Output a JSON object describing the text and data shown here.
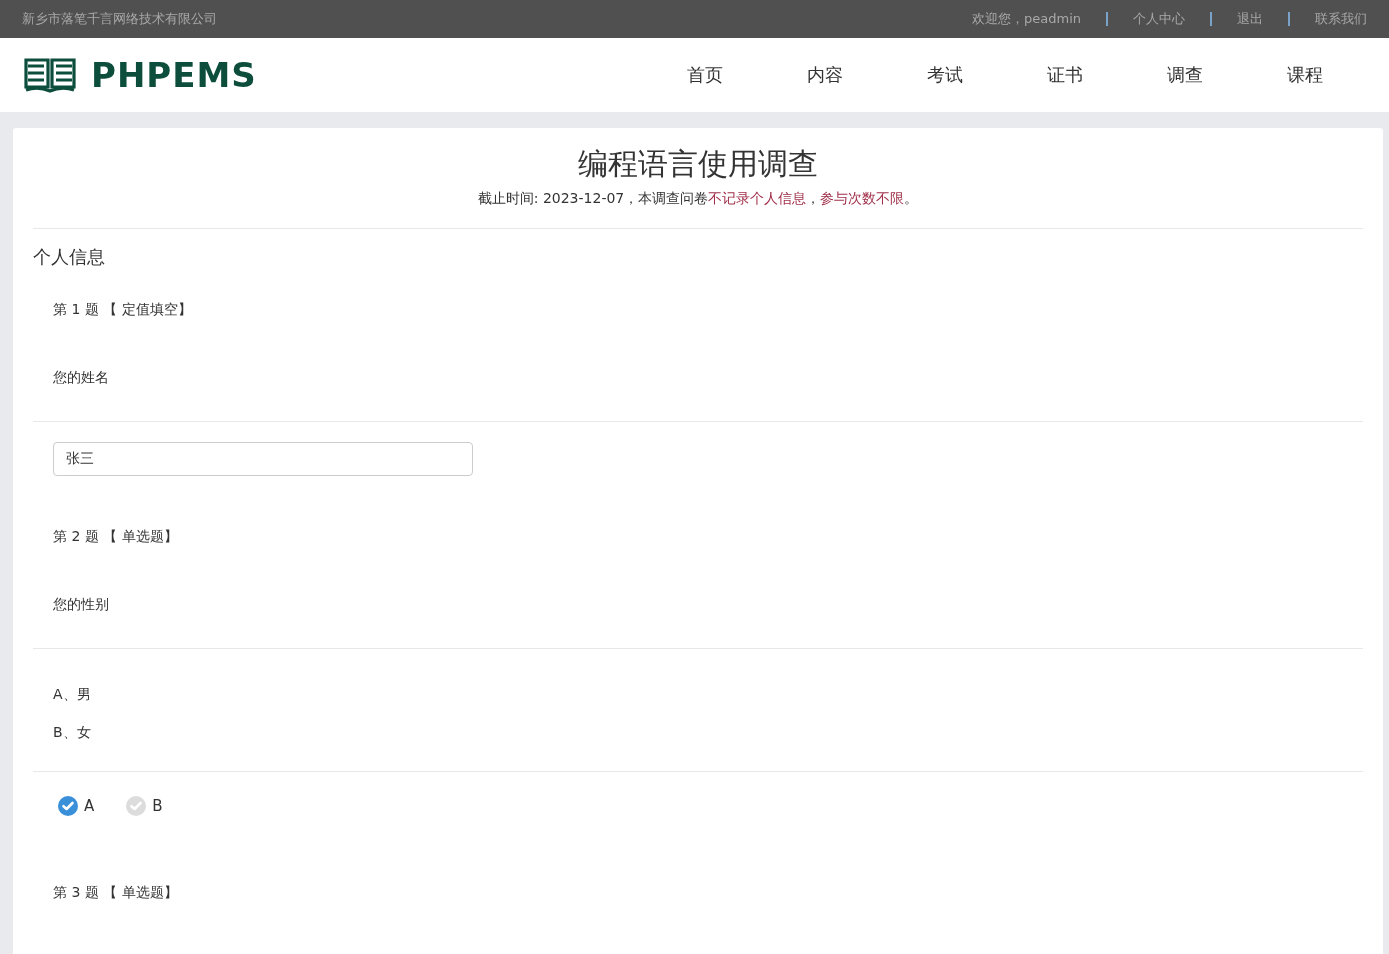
{
  "top_bar": {
    "company": "新乡市落笔千言网络技术有限公司",
    "links": [
      {
        "label": "欢迎您，peadmin"
      },
      {
        "label": "个人中心"
      },
      {
        "label": "退出"
      },
      {
        "label": "联系我们"
      }
    ]
  },
  "header": {
    "logo_text": "PHPEMS",
    "nav": [
      {
        "label": "首页"
      },
      {
        "label": "内容"
      },
      {
        "label": "考试"
      },
      {
        "label": "证书"
      },
      {
        "label": "调查"
      },
      {
        "label": "课程"
      }
    ]
  },
  "survey": {
    "title": "编程语言使用调查",
    "notice": [
      {
        "kind": "plain",
        "text": "截止时间: 2023-12-07，本调查问卷"
      },
      {
        "kind": "notice",
        "text": "不记录个人信息"
      },
      {
        "kind": "plain",
        "text": "，"
      },
      {
        "kind": "notice",
        "text": "参与次数不限"
      },
      {
        "kind": "plain",
        "text": "。"
      }
    ],
    "section": "个人信息",
    "questions": [
      {
        "kind": "fill",
        "header": "第 1 题 【 定值填空】",
        "stem": "您的姓名",
        "value": "张三"
      },
      {
        "kind": "single",
        "header": "第 2 题 【 单选题】",
        "stem": "您的性别",
        "options": [
          "A、男",
          "B、女"
        ],
        "choices": [
          {
            "label": "A",
            "selected": true
          },
          {
            "label": "B",
            "selected": false
          }
        ]
      },
      {
        "kind": "single",
        "header": "第 3 题 【 单选题】"
      }
    ]
  }
}
